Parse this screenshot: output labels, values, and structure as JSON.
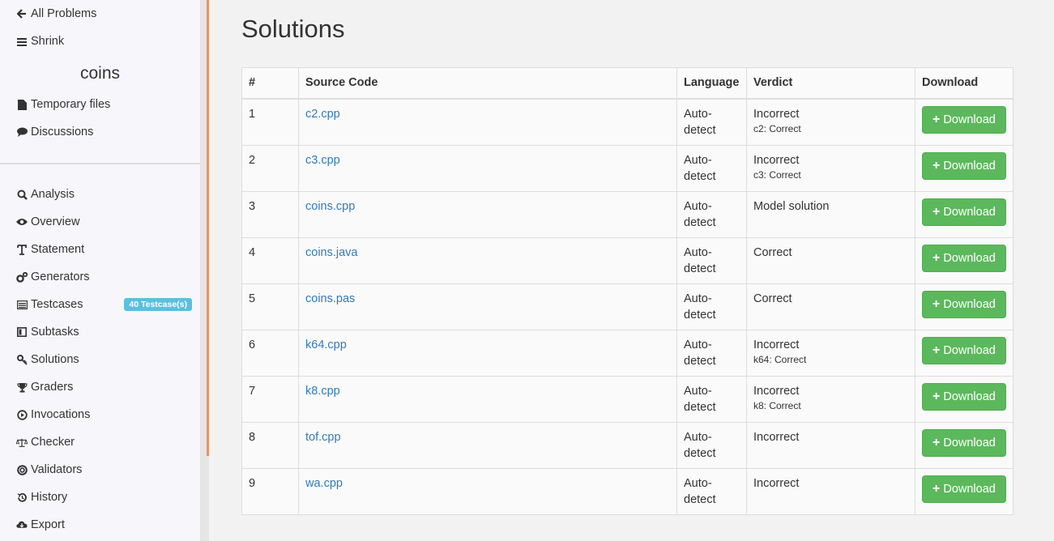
{
  "sidebar": {
    "top_links": [
      {
        "label": "All Problems",
        "icon": "arrow-left-icon"
      },
      {
        "label": "Shrink",
        "icon": "bars-icon"
      }
    ],
    "problem_name": "coins",
    "problem_links": [
      {
        "label": "Temporary files",
        "icon": "file-icon"
      },
      {
        "label": "Discussions",
        "icon": "comment-icon"
      }
    ],
    "section_links": [
      {
        "label": "Analysis",
        "icon": "search-icon"
      },
      {
        "label": "Overview",
        "icon": "eye-icon"
      },
      {
        "label": "Statement",
        "icon": "text-icon"
      },
      {
        "label": "Generators",
        "icon": "gears-icon"
      },
      {
        "label": "Testcases",
        "icon": "list-icon",
        "badge": "40 Testcase(s)"
      },
      {
        "label": "Subtasks",
        "icon": "columns-icon"
      },
      {
        "label": "Solutions",
        "icon": "key-icon"
      },
      {
        "label": "Graders",
        "icon": "trophy-icon"
      },
      {
        "label": "Invocations",
        "icon": "play-circle-icon"
      },
      {
        "label": "Checker",
        "icon": "scale-icon"
      },
      {
        "label": "Validators",
        "icon": "lifebuoy-icon"
      },
      {
        "label": "History",
        "icon": "history-icon"
      },
      {
        "label": "Export",
        "icon": "cloud-download-icon"
      }
    ]
  },
  "main": {
    "title": "Solutions",
    "table": {
      "headers": [
        "#",
        "Source Code",
        "Language",
        "Verdict",
        "Download"
      ],
      "download_label": "Download",
      "rows": [
        {
          "num": "1",
          "file": "c2.cpp",
          "lang1": "Auto-",
          "lang2": "detect",
          "verdict": "Incorrect",
          "sub": "c2: Correct"
        },
        {
          "num": "2",
          "file": "c3.cpp",
          "lang1": "Auto-",
          "lang2": "detect",
          "verdict": "Incorrect",
          "sub": "c3: Correct"
        },
        {
          "num": "3",
          "file": "coins.cpp",
          "lang1": "Auto-",
          "lang2": "detect",
          "verdict": "Model solution",
          "sub": ""
        },
        {
          "num": "4",
          "file": "coins.java",
          "lang1": "Auto-",
          "lang2": "detect",
          "verdict": "Correct",
          "sub": ""
        },
        {
          "num": "5",
          "file": "coins.pas",
          "lang1": "Auto-",
          "lang2": "detect",
          "verdict": "Correct",
          "sub": ""
        },
        {
          "num": "6",
          "file": "k64.cpp",
          "lang1": "Auto-",
          "lang2": "detect",
          "verdict": "Incorrect",
          "sub": "k64: Correct"
        },
        {
          "num": "7",
          "file": "k8.cpp",
          "lang1": "Auto-",
          "lang2": "detect",
          "verdict": "Incorrect",
          "sub": "k8: Correct"
        },
        {
          "num": "8",
          "file": "tof.cpp",
          "lang1": "Auto-",
          "lang2": "detect",
          "verdict": "Incorrect",
          "sub": ""
        },
        {
          "num": "9",
          "file": "wa.cpp",
          "lang1": "Auto-",
          "lang2": "detect",
          "verdict": "Incorrect",
          "sub": ""
        }
      ]
    }
  },
  "colors": {
    "accent_orange": "#f0915e",
    "link_blue": "#337ab7",
    "success_green": "#5cb85c",
    "badge_blue": "#5bc0de"
  }
}
